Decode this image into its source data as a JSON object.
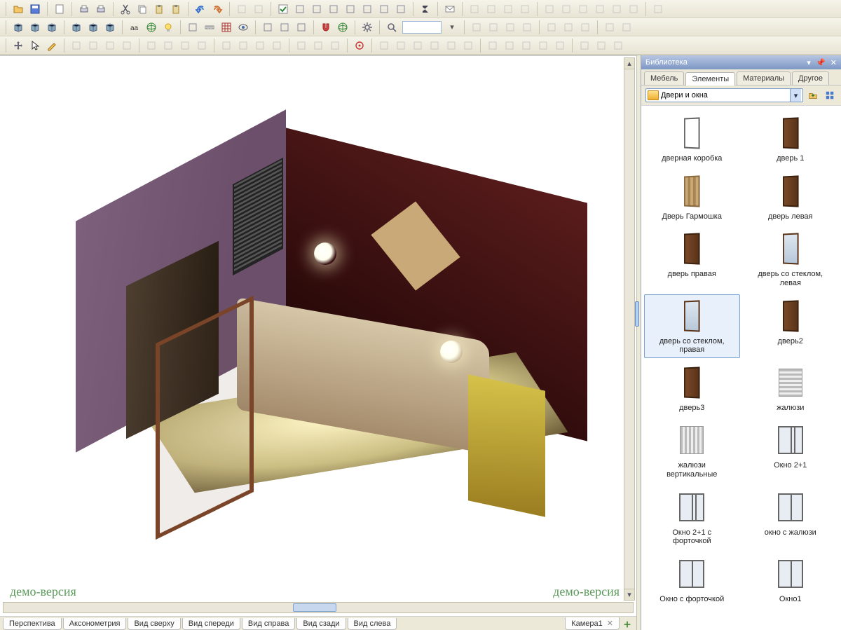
{
  "demo_text": "демо-версия",
  "view_tabs": {
    "items": [
      "Перспектива",
      "Аксонометрия",
      "Вид сверху",
      "Вид спереди",
      "Вид справа",
      "Вид сзади",
      "Вид слева"
    ],
    "camera": "Камера1"
  },
  "library": {
    "title": "Библиотека",
    "tabs": [
      "Мебель",
      "Элементы",
      "Материалы",
      "Другое"
    ],
    "active_tab": 1,
    "category_value": "Двери и окна",
    "items": [
      {
        "label": "дверная коробка",
        "thumb": "frame"
      },
      {
        "label": "дверь 1",
        "thumb": "wood"
      },
      {
        "label": "Дверь Гармошка",
        "thumb": "fold"
      },
      {
        "label": "дверь левая",
        "thumb": "wood"
      },
      {
        "label": "дверь правая",
        "thumb": "wood"
      },
      {
        "label": "дверь со стеклом, левая",
        "thumb": "glass"
      },
      {
        "label": "дверь со стеклом, правая",
        "thumb": "glass",
        "selected": true
      },
      {
        "label": "дверь2",
        "thumb": "wood"
      },
      {
        "label": "дверь3",
        "thumb": "wood"
      },
      {
        "label": "жалюзи",
        "thumb": "blinds"
      },
      {
        "label": "жалюзи вертикальные",
        "thumb": "vblinds"
      },
      {
        "label": "Окно 2+1",
        "thumb": "window-tri"
      },
      {
        "label": "Окно 2+1 с форточкой",
        "thumb": "window-tri"
      },
      {
        "label": "окно с жалюзи",
        "thumb": "window"
      },
      {
        "label": "Окно с форточкой",
        "thumb": "window"
      },
      {
        "label": "Окно1",
        "thumb": "window"
      }
    ]
  },
  "toolbars": {
    "row1": [
      "doc-open",
      "doc-save",
      "sep",
      "new",
      "sep",
      "print",
      "print-preview",
      "sep",
      "cut",
      "copy",
      "paste",
      "paste-sp",
      "sep",
      "undo",
      "redo",
      "sep",
      "dim01",
      "dim02",
      "sep",
      "check-edit",
      "layout-a",
      "layout-b",
      "layout-c",
      "layout-d",
      "layout-e",
      "layout-f",
      "layout-g",
      "sep",
      "sigma",
      "sep",
      "mail",
      "sep",
      "dim03",
      "dim04",
      "dim05",
      "dim06",
      "sep",
      "dim07",
      "dim08",
      "dim09",
      "dim10",
      "dim11",
      "dim12",
      "sep",
      "dim13"
    ],
    "row2": [
      "box-shade",
      "wall-a",
      "wall-b",
      "sep",
      "box-a",
      "box-b",
      "box-c",
      "sep",
      "aa",
      "sphere-a",
      "bulb",
      "sep",
      "snap-a",
      "ruler",
      "grid",
      "eye",
      "sep",
      "shape-a",
      "shape-b",
      "shape-c",
      "sep",
      "magnet",
      "globe",
      "sep",
      "gear",
      "sep",
      "zoom",
      "INPUT",
      "dd",
      "sep",
      "dim20",
      "dim21",
      "dim22",
      "dim23",
      "sep",
      "dim24",
      "dim25",
      "dim26",
      "sep",
      "dim27",
      "dim28"
    ],
    "row3": [
      "sep",
      "pan",
      "cursor",
      "pen",
      "sep",
      "dim30",
      "dim31",
      "dim32",
      "dim33",
      "sep",
      "dim34",
      "dim35",
      "dim36",
      "dim37",
      "sep",
      "dim38",
      "dim39",
      "dim40",
      "dim41",
      "sep",
      "dim42",
      "dim43",
      "dim44",
      "sep",
      "target",
      "sep",
      "dim45",
      "dim46",
      "dim47",
      "dim48",
      "dim49",
      "dim50",
      "sep",
      "dim51",
      "dim52",
      "dim53",
      "dim54",
      "dim55",
      "sep",
      "dim56",
      "dim57",
      "dim58"
    ]
  }
}
